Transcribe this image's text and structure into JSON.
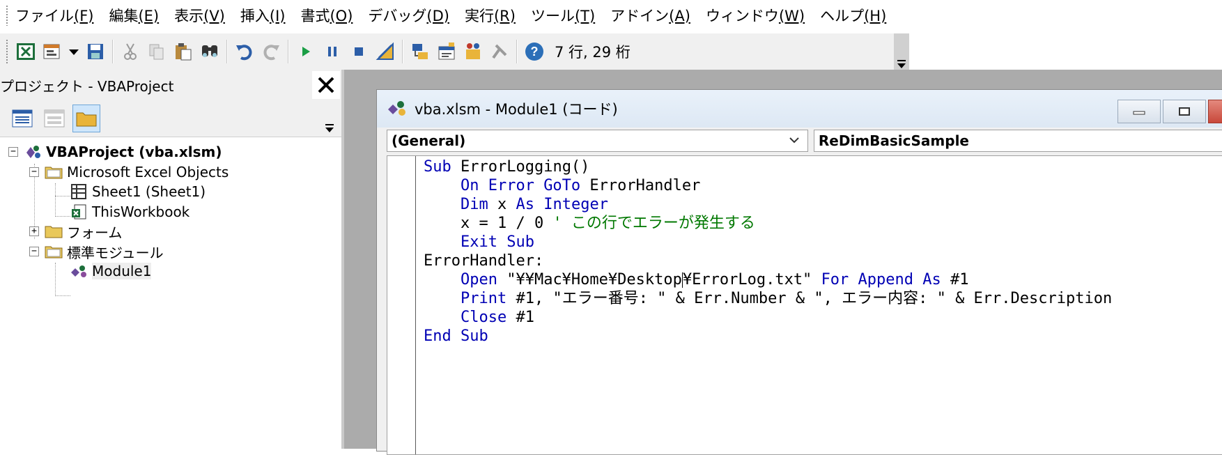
{
  "menubar": {
    "items": [
      {
        "label": "ファイル",
        "key": "(F)"
      },
      {
        "label": "編集",
        "key": "(E)"
      },
      {
        "label": "表示",
        "key": "(V)"
      },
      {
        "label": "挿入",
        "key": "(I)"
      },
      {
        "label": "書式",
        "key": "(O)"
      },
      {
        "label": "デバッグ",
        "key": "(D)"
      },
      {
        "label": "実行",
        "key": "(R)"
      },
      {
        "label": "ツール",
        "key": "(T)"
      },
      {
        "label": "アドイン",
        "key": "(A)"
      },
      {
        "label": "ウィンドウ",
        "key": "(W)"
      },
      {
        "label": "ヘルプ",
        "key": "(H)"
      }
    ]
  },
  "toolbar": {
    "status": "7 行, 29 桁",
    "icons": [
      "excel-icon",
      "insert-userform-icon",
      "save-icon",
      "cut-icon",
      "copy-icon",
      "paste-icon",
      "find-icon",
      "undo-icon",
      "redo-icon",
      "run-icon",
      "break-icon",
      "reset-icon",
      "design-mode-icon",
      "project-explorer-icon",
      "properties-icon",
      "object-browser-icon",
      "toolbox-icon",
      "help-icon"
    ]
  },
  "project": {
    "title": "プロジェクト - VBAProject",
    "tree": {
      "root": "VBAProject (vba.xlsm)",
      "excel_objects": "Microsoft Excel Objects",
      "sheet1": "Sheet1 (Sheet1)",
      "thisworkbook": "ThisWorkbook",
      "forms": "フォーム",
      "modules": "標準モジュール",
      "module1": "Module1"
    }
  },
  "code_window": {
    "title": "vba.xlsm - Module1 (コード)",
    "object_combo": "(General)",
    "procedure_combo": "ReDimBasicSample",
    "lines": [
      [
        {
          "t": "Sub",
          "c": "kw"
        },
        {
          "t": " ErrorLogging()",
          "c": ""
        }
      ],
      [
        {
          "t": "    ",
          "c": ""
        },
        {
          "t": "On Error GoTo",
          "c": "kw"
        },
        {
          "t": " ErrorHandler",
          "c": ""
        }
      ],
      [
        {
          "t": "    ",
          "c": ""
        },
        {
          "t": "Dim",
          "c": "kw"
        },
        {
          "t": " x ",
          "c": ""
        },
        {
          "t": "As Integer",
          "c": "kw"
        }
      ],
      [
        {
          "t": "    x = 1 / 0 ",
          "c": ""
        },
        {
          "t": "' この行でエラーが発生する",
          "c": "cm"
        }
      ],
      [
        {
          "t": "    ",
          "c": ""
        },
        {
          "t": "Exit Sub",
          "c": "kw"
        }
      ],
      [
        {
          "t": "ErrorHandler:",
          "c": ""
        }
      ],
      [
        {
          "t": "    ",
          "c": ""
        },
        {
          "t": "Open",
          "c": "kw"
        },
        {
          "t": " \"¥¥Mac¥Home¥Desktop",
          "c": ""
        },
        {
          "t": "|",
          "c": "caret"
        },
        {
          "t": "¥ErrorLog.txt\" ",
          "c": ""
        },
        {
          "t": "For Append As",
          "c": "kw"
        },
        {
          "t": " #1",
          "c": ""
        }
      ],
      [
        {
          "t": "    ",
          "c": ""
        },
        {
          "t": "Print",
          "c": "kw"
        },
        {
          "t": " #1, \"エラー番号: \" & Err.Number & \", エラー内容: \" & Err.Description",
          "c": ""
        }
      ],
      [
        {
          "t": "    ",
          "c": ""
        },
        {
          "t": "Close",
          "c": "kw"
        },
        {
          "t": " #1",
          "c": ""
        }
      ],
      [
        {
          "t": "End Sub",
          "c": "kw"
        }
      ]
    ]
  }
}
